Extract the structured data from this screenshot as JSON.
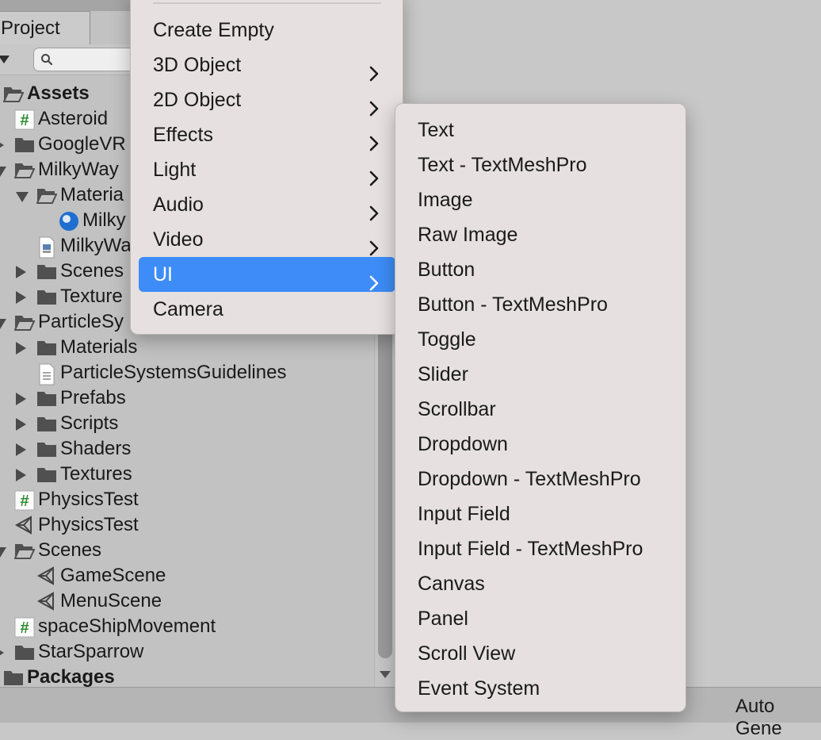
{
  "project_panel": {
    "tab_label": "Project",
    "tree": [
      {
        "label": "Assets",
        "bold": true,
        "icon": "folder-open-icon",
        "arrow": "down"
      },
      {
        "label": "Asteroid",
        "icon": "csharp-script-icon",
        "arrow": "none"
      },
      {
        "label": "GoogleVR",
        "icon": "folder-icon",
        "arrow": "right"
      },
      {
        "label": "MilkyWay",
        "icon": "folder-open-icon",
        "arrow": "down"
      },
      {
        "label": "Materia",
        "icon": "folder-open-icon",
        "arrow": "down"
      },
      {
        "label": "Milky",
        "icon": "material-sphere-icon",
        "arrow": "none"
      },
      {
        "label": "MilkyWa",
        "icon": "image-file-icon",
        "arrow": "none"
      },
      {
        "label": "Scenes",
        "icon": "folder-icon",
        "arrow": "right"
      },
      {
        "label": "Texture",
        "icon": "folder-icon",
        "arrow": "right"
      },
      {
        "label": "ParticleSy",
        "icon": "folder-open-icon",
        "arrow": "down"
      },
      {
        "label": "Materials",
        "icon": "folder-icon",
        "arrow": "right"
      },
      {
        "label": "ParticleSystemsGuidelines",
        "icon": "text-file-icon",
        "arrow": "none"
      },
      {
        "label": "Prefabs",
        "icon": "folder-icon",
        "arrow": "right"
      },
      {
        "label": "Scripts",
        "icon": "folder-icon",
        "arrow": "right"
      },
      {
        "label": "Shaders",
        "icon": "folder-icon",
        "arrow": "right"
      },
      {
        "label": "Textures",
        "icon": "folder-icon",
        "arrow": "right"
      },
      {
        "label": "PhysicsTest",
        "icon": "csharp-script-icon",
        "arrow": "none"
      },
      {
        "label": "PhysicsTest",
        "icon": "unity-scene-icon",
        "arrow": "none"
      },
      {
        "label": "Scenes",
        "icon": "folder-open-icon",
        "arrow": "down"
      },
      {
        "label": "GameScene",
        "icon": "unity-scene-icon",
        "arrow": "none"
      },
      {
        "label": "MenuScene",
        "icon": "unity-scene-icon",
        "arrow": "none"
      },
      {
        "label": "spaceShipMovement",
        "icon": "csharp-script-icon",
        "arrow": "none"
      },
      {
        "label": "StarSparrow",
        "icon": "folder-icon",
        "arrow": "right"
      },
      {
        "label": "Packages",
        "bold": true,
        "icon": "folder-icon",
        "arrow": "right"
      }
    ]
  },
  "main_menu": {
    "items": [
      {
        "label": "Create Empty",
        "submenu": false,
        "selected": false
      },
      {
        "label": "3D Object",
        "submenu": true,
        "selected": false
      },
      {
        "label": "2D Object",
        "submenu": true,
        "selected": false
      },
      {
        "label": "Effects",
        "submenu": true,
        "selected": false
      },
      {
        "label": "Light",
        "submenu": true,
        "selected": false
      },
      {
        "label": "Audio",
        "submenu": true,
        "selected": false
      },
      {
        "label": "Video",
        "submenu": true,
        "selected": false
      },
      {
        "label": "UI",
        "submenu": true,
        "selected": true
      },
      {
        "label": "Camera",
        "submenu": false,
        "selected": false
      }
    ]
  },
  "ui_submenu": {
    "items": [
      "Text",
      "Text - TextMeshPro",
      "Image",
      "Raw Image",
      "Button",
      "Button - TextMeshPro",
      "Toggle",
      "Slider",
      "Scrollbar",
      "Dropdown",
      "Dropdown - TextMeshPro",
      "Input Field",
      "Input Field - TextMeshPro",
      "Canvas",
      "Panel",
      "Scroll View",
      "Event System"
    ]
  },
  "status_bar": {
    "text": "Auto Gene"
  },
  "colors": {
    "selection": "#3d8cf7",
    "menu_bg": "#e6e0e0",
    "script_hash": "#2e8b2e",
    "folder": "#505050"
  }
}
